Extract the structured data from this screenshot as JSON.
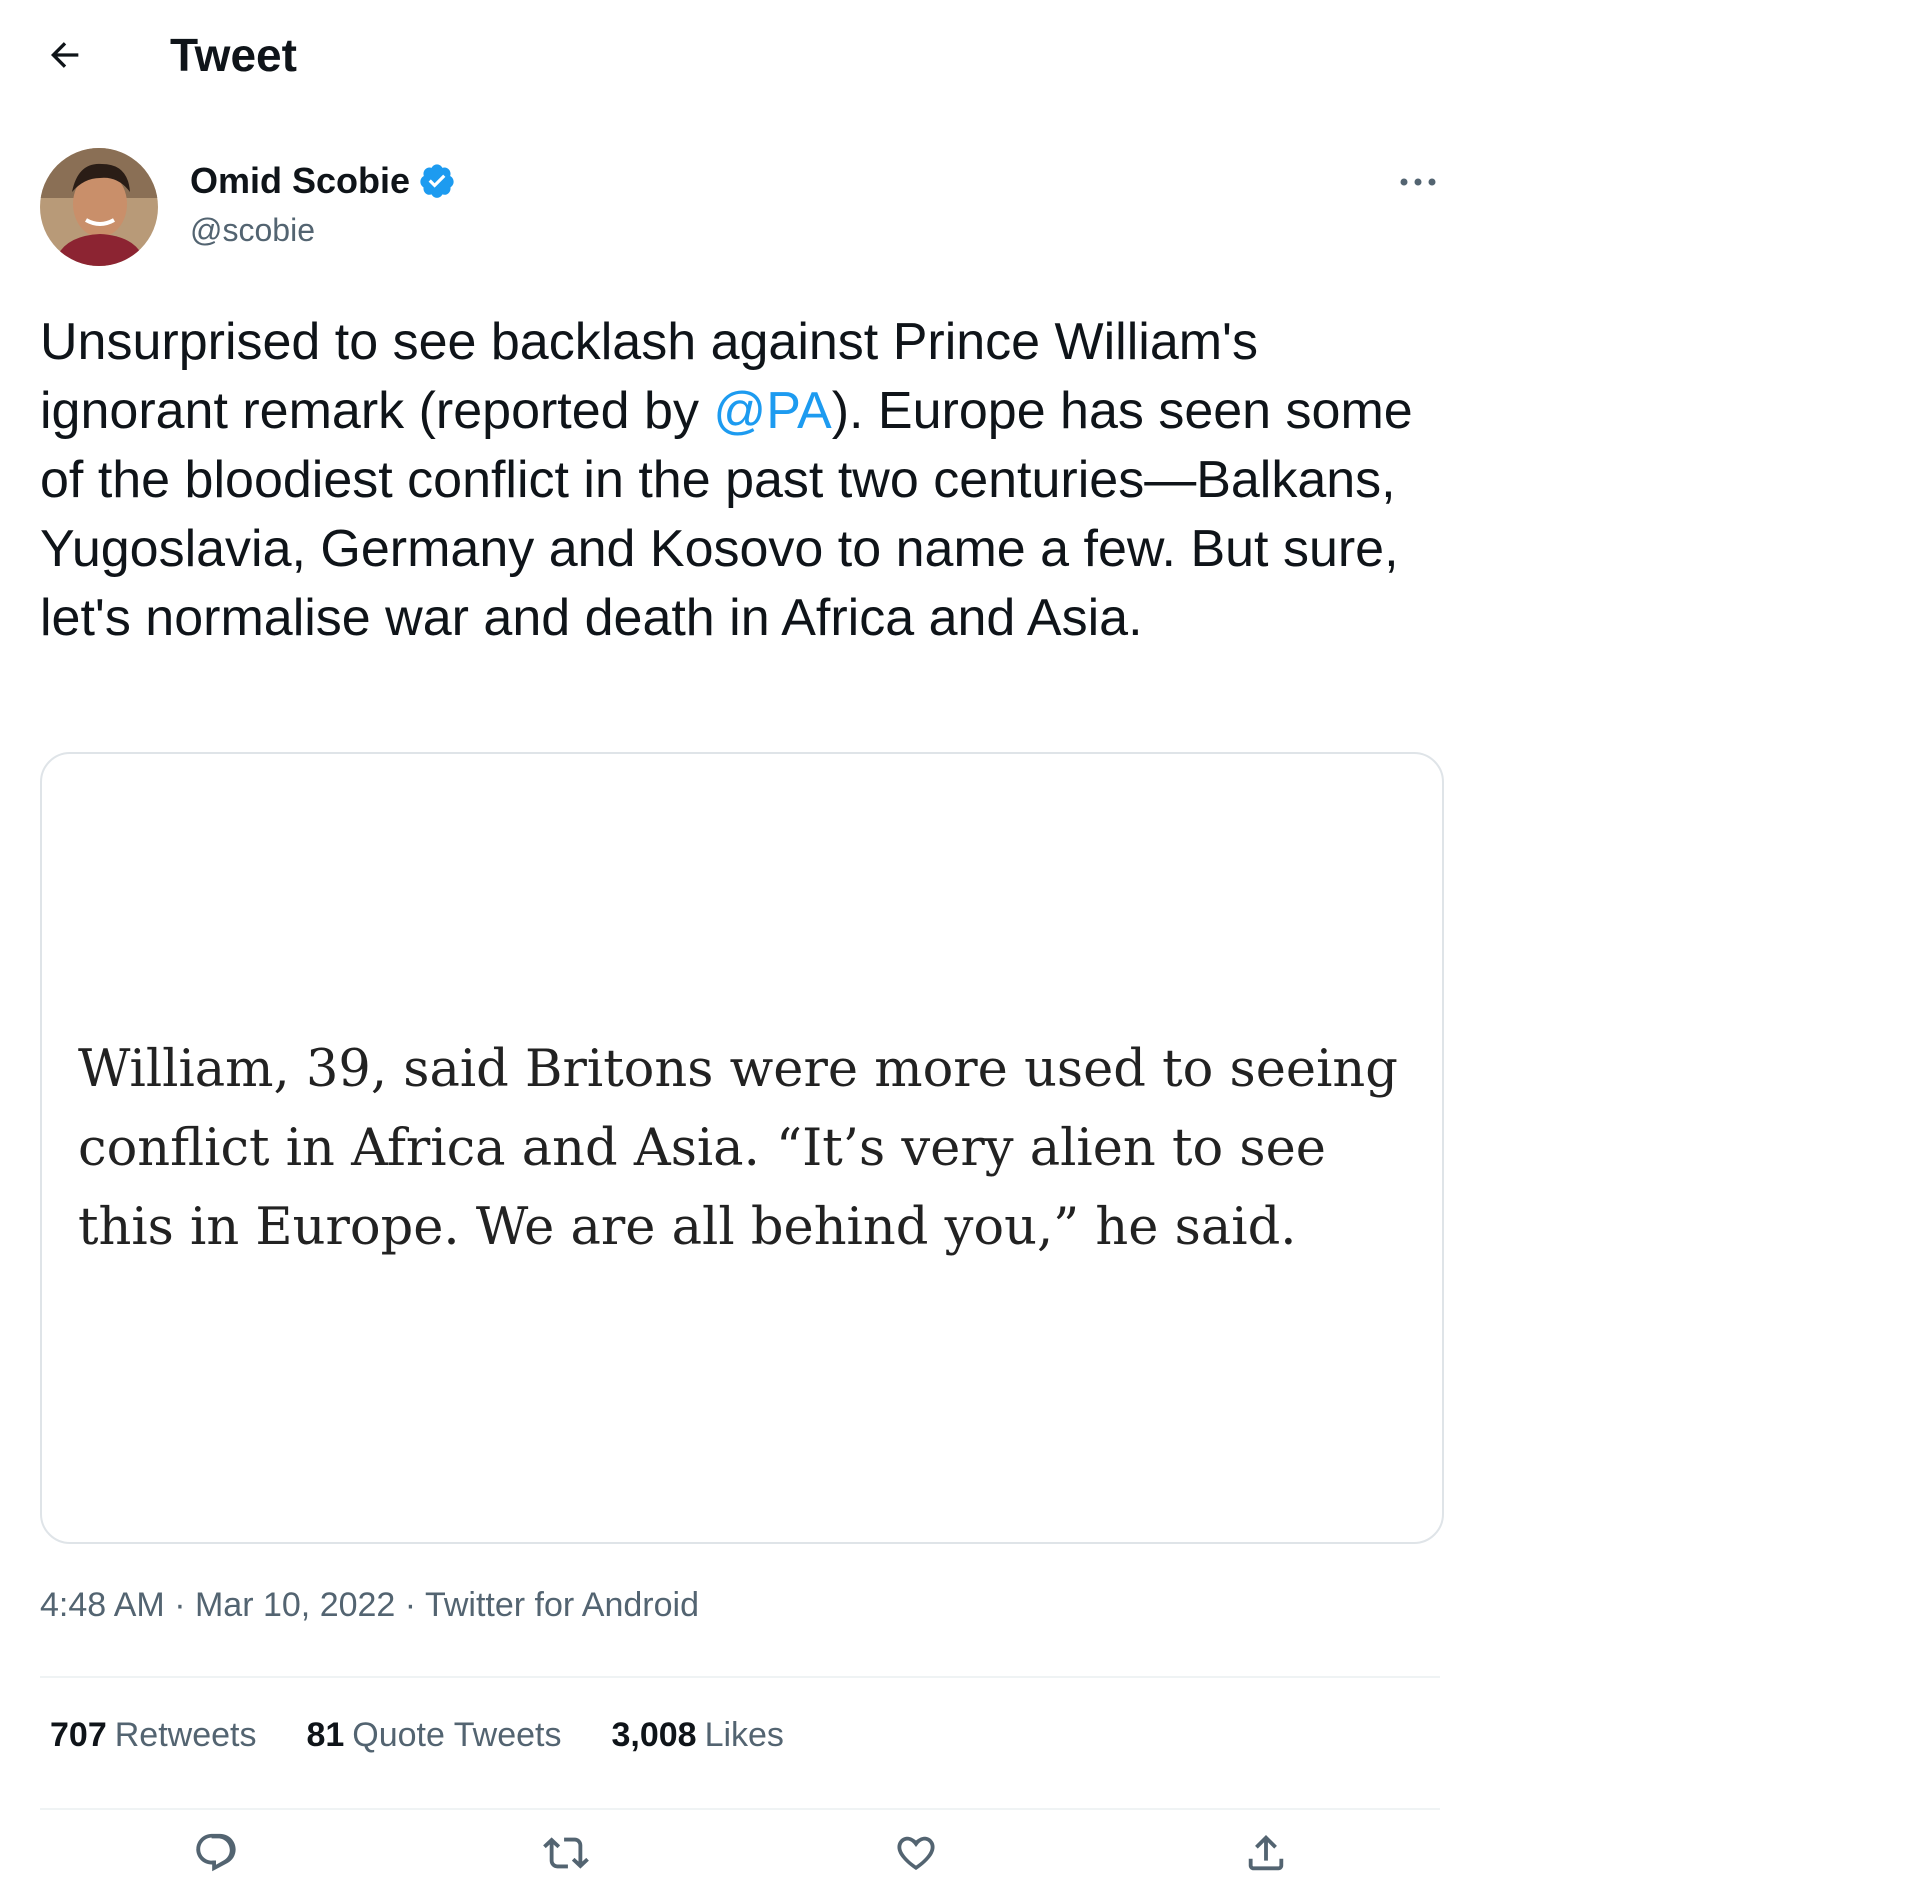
{
  "header": {
    "title": "Tweet"
  },
  "author": {
    "name": "Omid Scobie",
    "handle": "@scobie"
  },
  "tweet": {
    "text_before": "Unsurprised to see backlash against Prince William's ignorant remark (reported by ",
    "mention": "@PA",
    "text_after": "). Europe has seen some of the bloodiest conflict in the past two centuries—Balkans, Yugoslavia, Germany and Kosovo to name a few. But sure, let's normalise war and death in Africa and Asia."
  },
  "media": {
    "quote_text": "William, 39, said Britons were more used to seeing conflict in Africa and Asia. “It’s very alien to see this in Europe. We are all behind you,” he said."
  },
  "meta": {
    "time": "4:48 AM",
    "date": "Mar 10, 2022",
    "source": "Twitter for Android",
    "separator": "·"
  },
  "stats": [
    {
      "count": "707",
      "label": "Retweets"
    },
    {
      "count": "81",
      "label": "Quote Tweets"
    },
    {
      "count": "3,008",
      "label": "Likes"
    }
  ],
  "actions": [
    "reply-icon",
    "retweet-icon",
    "like-icon",
    "share-icon"
  ],
  "colors": {
    "link": "#1d9bf0",
    "secondary": "#536471",
    "text": "#0f1419",
    "verified": "#1d9bf0"
  }
}
